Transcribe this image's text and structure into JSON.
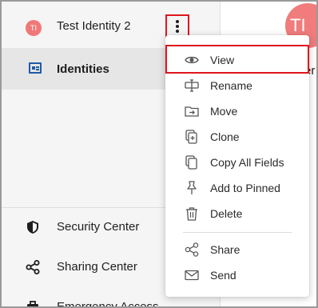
{
  "sidebar": {
    "current_item": {
      "avatar_initials": "TI",
      "label": "Test Identity 2"
    },
    "identities_label": "Identities",
    "bottom_items": [
      {
        "label": "Security Center",
        "icon": "shield-icon"
      },
      {
        "label": "Sharing Center",
        "icon": "share-icon"
      },
      {
        "label": "Emergency Access",
        "icon": "emergency-icon"
      }
    ]
  },
  "content": {
    "avatar_initials": "TI",
    "text": "er"
  },
  "menu": {
    "items": [
      {
        "label": "View",
        "icon": "eye-icon"
      },
      {
        "label": "Rename",
        "icon": "rename-icon"
      },
      {
        "label": "Move",
        "icon": "folder-move-icon"
      },
      {
        "label": "Clone",
        "icon": "clone-icon"
      },
      {
        "label": "Copy All Fields",
        "icon": "copy-icon"
      },
      {
        "label": "Add to Pinned",
        "icon": "pin-icon"
      },
      {
        "label": "Delete",
        "icon": "trash-icon"
      },
      {
        "label": "Share",
        "icon": "share-icon"
      },
      {
        "label": "Send",
        "icon": "envelope-icon"
      }
    ]
  },
  "colors": {
    "highlight": "#e0161d",
    "avatar": "#f07878",
    "identities_icon": "#1e5aa6"
  }
}
